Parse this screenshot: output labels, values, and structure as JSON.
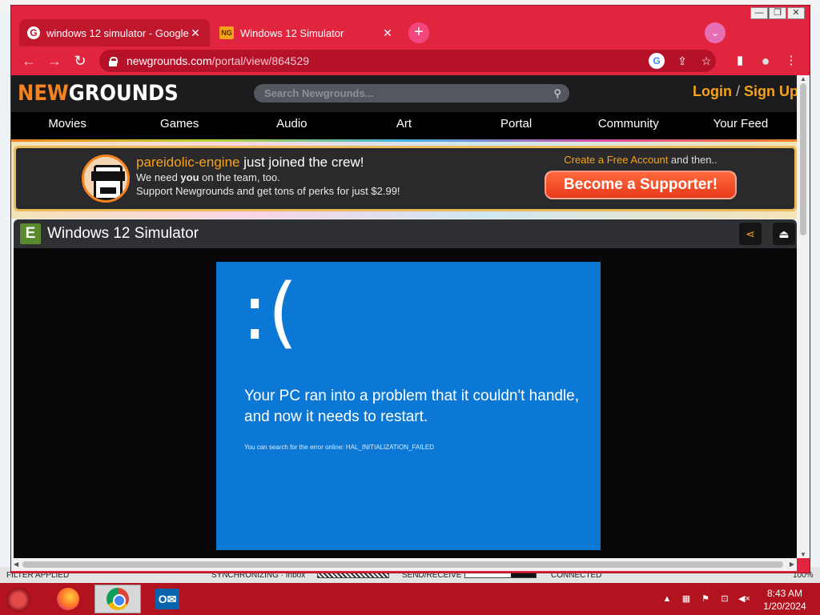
{
  "background_app": {
    "status_filter": "FILTER APPLIED",
    "status_sync": "SYNCHRONIZING · Inbox",
    "status_send": "SEND/RECEIVE",
    "status_connection": "CONNECTED",
    "zoom": "100%"
  },
  "window": {
    "minimize": "—",
    "restore": "❐",
    "close": "✕"
  },
  "tabs": [
    {
      "title": "windows 12 simulator - Google S",
      "favicon": "G",
      "close": "✕"
    },
    {
      "title": "Windows 12 Simulator",
      "favicon": "NG",
      "close": "✕"
    }
  ],
  "new_tab": "+",
  "tab_search": "⌄",
  "toolbar": {
    "back": "←",
    "forward": "→",
    "reload": "↻",
    "url_host": "newgrounds.com",
    "url_path": "/portal/view/864529",
    "google_icon": "G",
    "share_icon": "⇪",
    "star_icon": "☆",
    "sidebar_icon": "▮",
    "profile_icon": "●",
    "menu_icon": "⋮"
  },
  "newgrounds": {
    "logo_new": "NEW",
    "logo_grounds": "GROUNDS",
    "search_placeholder": "Search Newgrounds...",
    "login": "Login",
    "separator": " / ",
    "signup": "Sign Up",
    "nav": [
      "Movies",
      "Games",
      "Audio",
      "Art",
      "Portal",
      "Community",
      "Your Feed"
    ]
  },
  "banner": {
    "username": "pareidolic-engine",
    "joined": " just joined the crew!",
    "line2_pre": "We need ",
    "line2_bold": "you",
    "line2_post": " on the team, too.",
    "line3": "Support Newgrounds and get tons of perks for just $2.99!",
    "cta_link": "Create a Free Account",
    "cta_post": " and then..",
    "button": "Become a Supporter!"
  },
  "game": {
    "icon": "E",
    "title": "Windows 12 Simulator",
    "share_icon": "⋖",
    "fullscreen_icon": "⏏",
    "bsod_face": ":(",
    "bsod_message": "Your PC ran into a problem that it couldn't handle, and now it needs to restart.",
    "bsod_detail": "You can search for the error online: HAL_INITIALIZATION_FAILED"
  },
  "taskbar": {
    "outlook_label": "O✉",
    "tray_arrow": "▲",
    "time": "8:43 AM",
    "date": "1/20/2024"
  },
  "colors": {
    "browser_frame": "#e2253f",
    "ng_orange": "#f7a21b",
    "bsod_blue": "#0c78d5",
    "taskbar": "#b3131f"
  }
}
